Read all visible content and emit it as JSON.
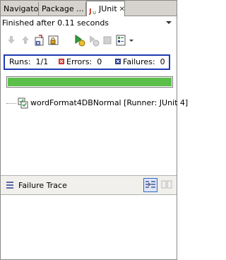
{
  "tabs": [
    {
      "label": "Navigator"
    },
    {
      "label": "Package ..."
    },
    {
      "label": "JUnit",
      "active": true
    }
  ],
  "close_glyph": "✕",
  "status_text": "Finished after 0.11 seconds",
  "counters": {
    "runs_label": "Runs:",
    "runs_value": "1/1",
    "errors_label": "Errors:",
    "errors_value": "0",
    "failures_label": "Failures:",
    "failures_value": "0"
  },
  "progress": {
    "fraction": 1.0,
    "color": "#5bbf4a"
  },
  "tree": {
    "items": [
      {
        "label": "wordFormat4DBNormal [Runner: JUnit 4]"
      }
    ]
  },
  "failure_trace": {
    "title": "Failure Trace"
  },
  "colors": {
    "highlight_border": "#1f3bb3",
    "error": "#d03030",
    "failure": "#2a3c8c"
  }
}
